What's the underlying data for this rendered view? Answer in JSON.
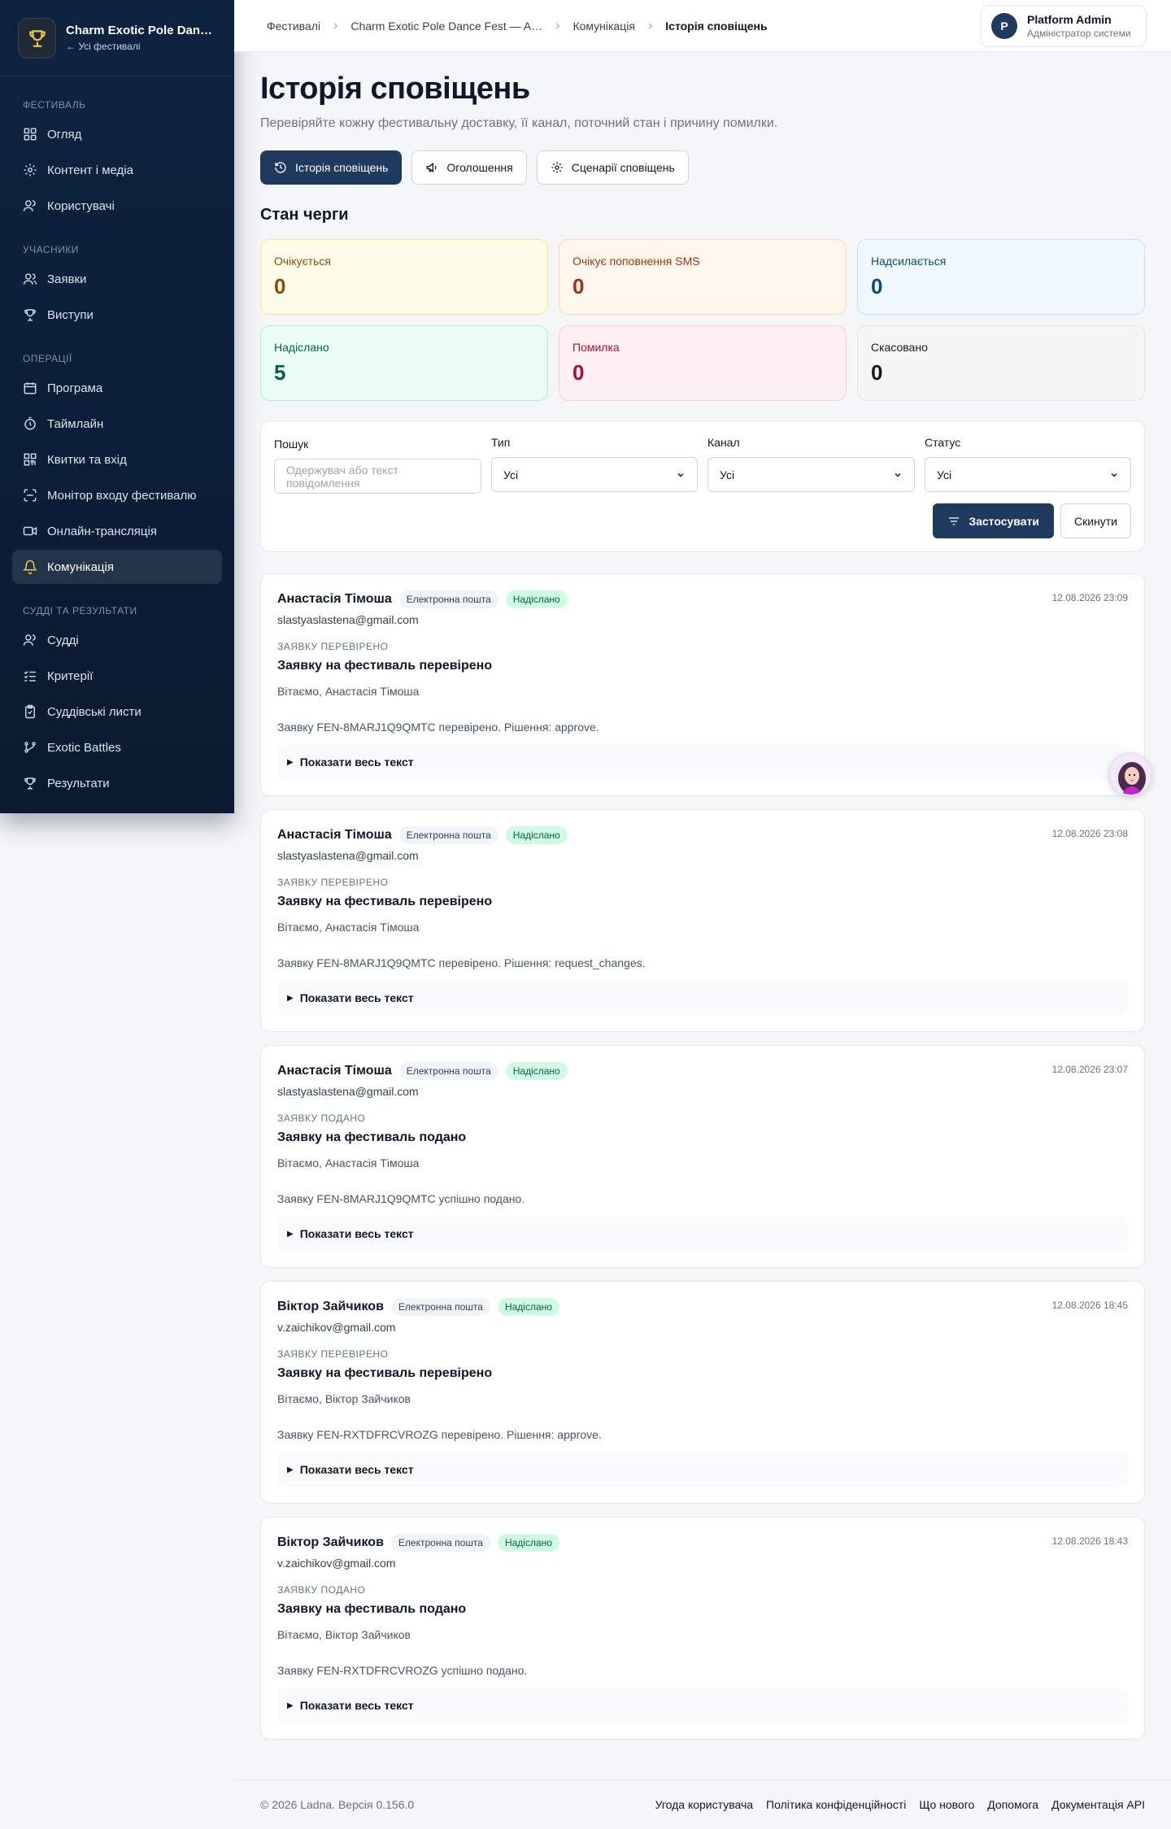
{
  "sidebar": {
    "brand_name": "Charm Exotic Pole Dance Fest",
    "brand_back": "← Усі фестивалі",
    "sections": [
      {
        "title": "Фестиваль",
        "items": [
          {
            "label": "Огляд",
            "icon": "grid-icon"
          },
          {
            "label": "Контент і медіа",
            "icon": "gear-icon"
          },
          {
            "label": "Користувачі",
            "icon": "user-icon"
          }
        ]
      },
      {
        "title": "Учасники",
        "items": [
          {
            "label": "Заявки",
            "icon": "users-icon"
          },
          {
            "label": "Виступи",
            "icon": "trophy-icon"
          }
        ]
      },
      {
        "title": "Операції",
        "items": [
          {
            "label": "Програма",
            "icon": "calendar-icon"
          },
          {
            "label": "Таймлайн",
            "icon": "stopwatch-icon"
          },
          {
            "label": "Квитки та вхід",
            "icon": "qr-icon"
          },
          {
            "label": "Монітор входу фестивалю",
            "icon": "monitor-icon"
          },
          {
            "label": "Онлайн-трансляція",
            "icon": "video-icon"
          },
          {
            "label": "Комунікація",
            "icon": "bell-icon",
            "active": true
          }
        ]
      },
      {
        "title": "Судді та результати",
        "items": [
          {
            "label": "Судді",
            "icon": "judges-icon"
          },
          {
            "label": "Критерії",
            "icon": "checklist-icon"
          },
          {
            "label": "Суддівські листи",
            "icon": "clipboard-icon"
          },
          {
            "label": "Exotic Battles",
            "icon": "branch-icon"
          },
          {
            "label": "Результати",
            "icon": "trophy-icon"
          }
        ]
      }
    ]
  },
  "breadcrumb": [
    "Фестивалі",
    "Charm Exotic Pole Dance Fest — A…",
    "Комунікація",
    "Історія сповіщень"
  ],
  "user": {
    "initial": "P",
    "name": "Platform Admin",
    "role": "Адміністратор системи"
  },
  "page": {
    "title": "Історія сповіщень",
    "subtitle": "Перевіряйте кожну фестивальну доставку, її канал, поточний стан і причину помилки."
  },
  "tabs": [
    {
      "label": "Історія сповіщень",
      "icon": "history-icon",
      "active": true
    },
    {
      "label": "Оголошення",
      "icon": "megaphone-icon"
    },
    {
      "label": "Сценарії сповіщень",
      "icon": "gear-icon"
    }
  ],
  "queue": {
    "title": "Стан черги",
    "stats": [
      {
        "label": "Очікується",
        "value": "0"
      },
      {
        "label": "Очікує поповнення SMS",
        "value": "0"
      },
      {
        "label": "Надсилається",
        "value": "0"
      },
      {
        "label": "Надіслано",
        "value": "5"
      },
      {
        "label": "Помилка",
        "value": "0"
      },
      {
        "label": "Скасовано",
        "value": "0"
      }
    ]
  },
  "filters": {
    "search_label": "Пошук",
    "search_placeholder": "Одержувач або текст повідомлення",
    "type_label": "Тип",
    "type_value": "Усі",
    "channel_label": "Канал",
    "channel_value": "Усі",
    "status_label": "Статус",
    "status_value": "Усі",
    "apply": "Застосувати",
    "reset": "Скинути"
  },
  "messages": [
    {
      "name": "Анастасія Тімоша",
      "channel": "Електронна пошта",
      "status": "Надіслано",
      "time": "12.08.2026 23:09",
      "email": "slastyaslastena@gmail.com",
      "category": "Заявку перевірено",
      "subject": "Заявку на фестиваль перевірено",
      "greeting": "Вітаємо, Анастасія Тімоша",
      "body": "Заявку FEN-8MARJ1Q9QMTC перевірено. Рішення: approve.",
      "expand": "Показати весь текст"
    },
    {
      "name": "Анастасія Тімоша",
      "channel": "Електронна пошта",
      "status": "Надіслано",
      "time": "12.08.2026 23:08",
      "email": "slastyaslastena@gmail.com",
      "category": "Заявку перевірено",
      "subject": "Заявку на фестиваль перевірено",
      "greeting": "Вітаємо, Анастасія Тімоша",
      "body": "Заявку FEN-8MARJ1Q9QMTC перевірено. Рішення: request_changes.",
      "expand": "Показати весь текст"
    },
    {
      "name": "Анастасія Тімоша",
      "channel": "Електронна пошта",
      "status": "Надіслано",
      "time": "12.08.2026 23:07",
      "email": "slastyaslastena@gmail.com",
      "category": "Заявку подано",
      "subject": "Заявку на фестиваль подано",
      "greeting": "Вітаємо, Анастасія Тімоша",
      "body": "Заявку FEN-8MARJ1Q9QMTC успішно подано.",
      "expand": "Показати весь текст"
    },
    {
      "name": "Віктор Зайчиков",
      "channel": "Електронна пошта",
      "status": "Надіслано",
      "time": "12.08.2026 18:45",
      "email": "v.zaichikov@gmail.com",
      "category": "Заявку перевірено",
      "subject": "Заявку на фестиваль перевірено",
      "greeting": "Вітаємо, Віктор Зайчиков",
      "body": "Заявку FEN-RXTDFRCVROZG перевірено. Рішення: approve.",
      "expand": "Показати весь текст"
    },
    {
      "name": "Віктор Зайчиков",
      "channel": "Електронна пошта",
      "status": "Надіслано",
      "time": "12.08.2026 18:43",
      "email": "v.zaichikov@gmail.com",
      "category": "Заявку подано",
      "subject": "Заявку на фестиваль подано",
      "greeting": "Вітаємо, Віктор Зайчиков",
      "body": "Заявку FEN-RXTDFRCVROZG успішно подано.",
      "expand": "Показати весь текст"
    }
  ],
  "footer": {
    "copyright": "© 2026 Ladna. Версія 0.156.0",
    "links": [
      "Угода користувача",
      "Політика конфіденційності",
      "Що нового",
      "Допомога",
      "Документація API"
    ]
  },
  "colors": {
    "sidebar_bg": "#0c2340",
    "accent": "#1e3a5f",
    "active_icon": "#f2c94c",
    "sent_badge": "#d1fae5"
  }
}
